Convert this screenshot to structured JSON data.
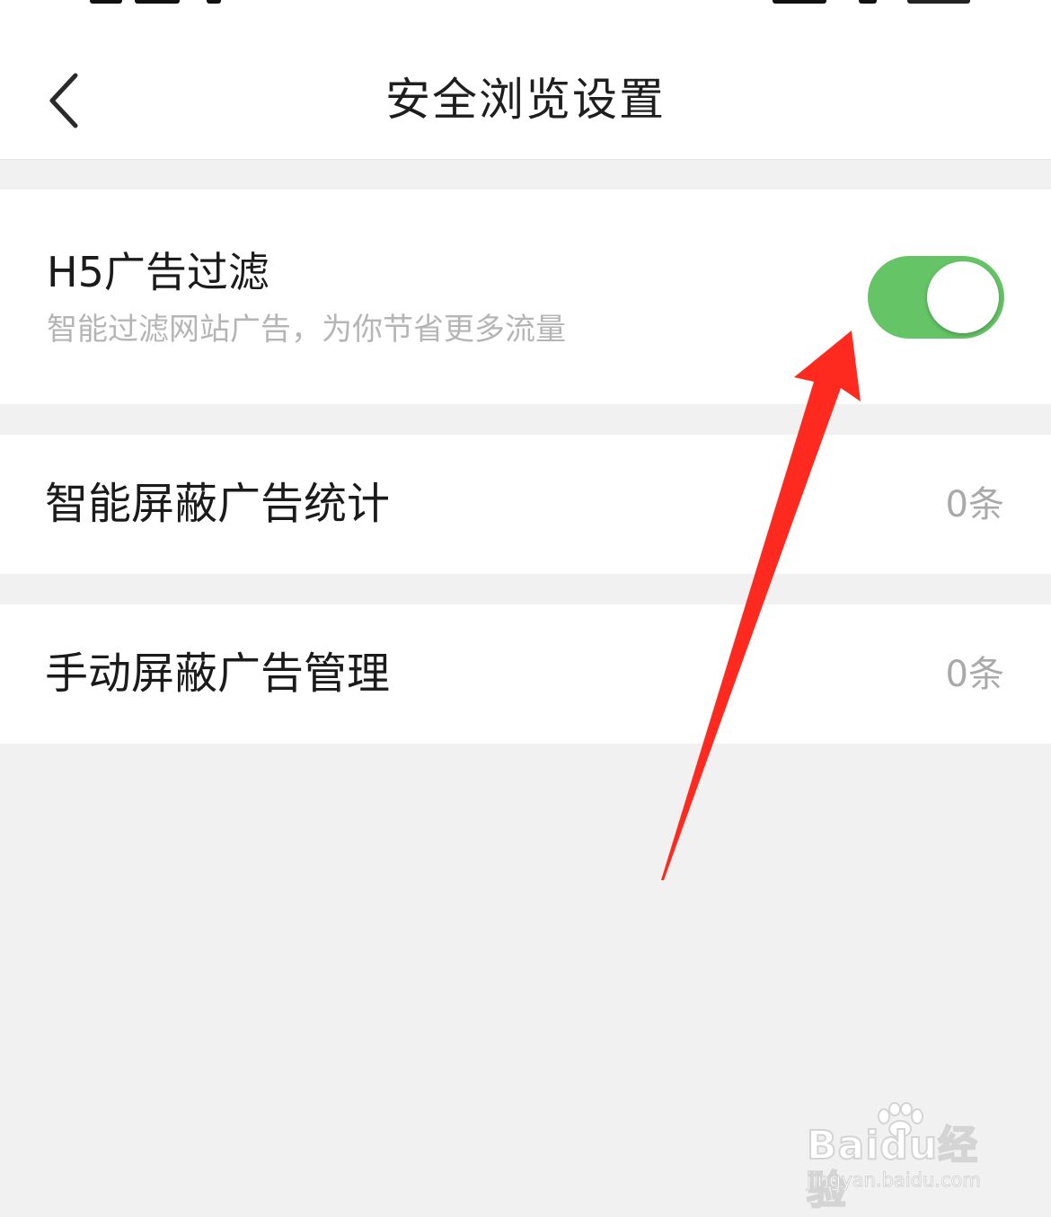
{
  "nav": {
    "title": "安全浏览设置",
    "back_icon": "chevron-left-icon"
  },
  "h5_filter": {
    "title": "H5广告过滤",
    "description": "智能过滤网站广告，为你节省更多流量",
    "toggle_on": true,
    "toggle_color": "#65c466"
  },
  "smart_block": {
    "label": "智能屏蔽广告统计",
    "value": "0条"
  },
  "manual_block": {
    "label": "手动屏蔽广告管理",
    "value": "0条"
  },
  "annotation": {
    "arrow_color": "#ff2a1f"
  },
  "watermark": {
    "logo": "Baidu经验",
    "url": "jingyan.baidu.com"
  }
}
